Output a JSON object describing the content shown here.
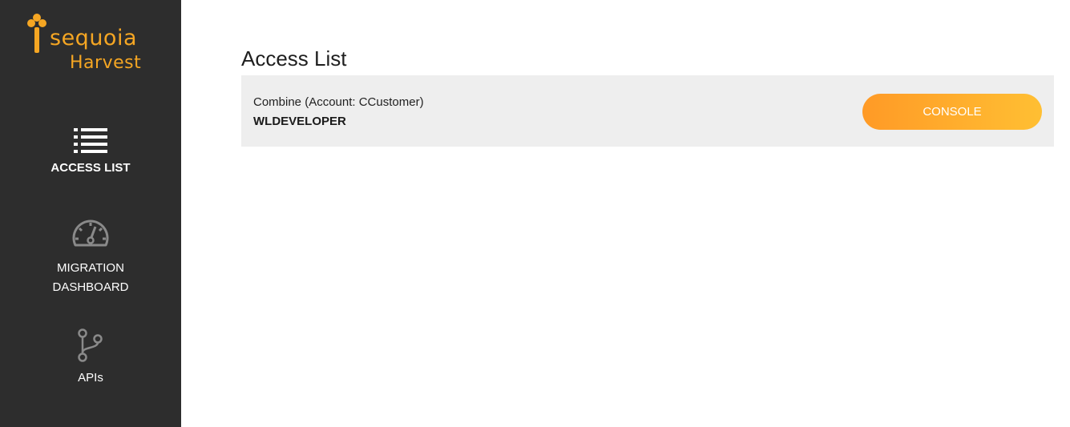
{
  "brand": {
    "name_line1": "sequoia",
    "name_line2": "Harvest",
    "accent_color": "#f5a623"
  },
  "sidebar": {
    "background": "#2d2d2d",
    "items": [
      {
        "label": "ACCESS LIST",
        "icon": "list-icon",
        "active": true
      },
      {
        "label_line1": "MIGRATION",
        "label_line2": "DASHBOARD",
        "icon": "gauge-icon",
        "active": false
      },
      {
        "label": "APIs",
        "icon": "branch-icon",
        "active": false
      }
    ]
  },
  "main": {
    "title": "Access List",
    "rows": [
      {
        "subtitle": "Combine (Account: CCustomer)",
        "title": "WLDEVELOPER",
        "button_label": "CONSOLE"
      }
    ]
  },
  "colors": {
    "button_gradient_start": "#ff9a26",
    "button_gradient_end": "#ffbf33",
    "row_background": "#eeeeee"
  }
}
